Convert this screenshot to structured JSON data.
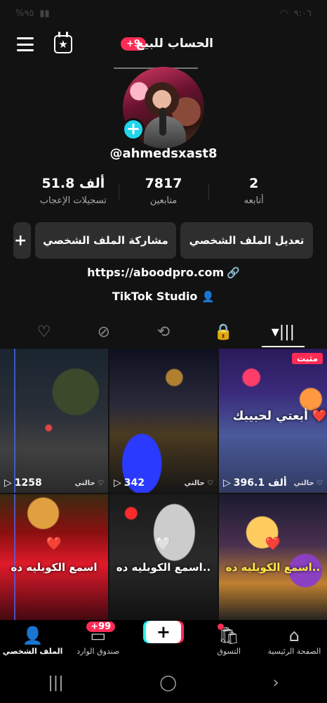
{
  "status_bar": {
    "battery": "%٩٥",
    "time": "٩:٠٦"
  },
  "header": {
    "title": "الحساب للبيع",
    "badge": "+9"
  },
  "profile": {
    "username": "@ahmedsxast8"
  },
  "stats": [
    {
      "value": "51.8 ألف",
      "label": "تسجيلات الإعجاب"
    },
    {
      "value": "7817",
      "label": "متابعين"
    },
    {
      "value": "2",
      "label": "أتابعه"
    }
  ],
  "actions": {
    "edit": "تعديل الملف الشخصي",
    "share": "مشاركة الملف الشخصي",
    "add": "+"
  },
  "link": "https://aboodpro.com",
  "studio": "TikTok Studio",
  "tabs": [
    "liked-icon",
    "hidden-icon",
    "repost-icon",
    "lock-icon",
    "videos-icon"
  ],
  "videos": [
    {
      "views": "1258",
      "caption_small": "حالتي ♡",
      "overlay": ""
    },
    {
      "views": "342",
      "caption_small": "حالتي ♡",
      "overlay": ""
    },
    {
      "views": "396.1 ألف",
      "caption_small": "حالتي ♡",
      "overlay": "أبعتي لحبيبك ❤️",
      "pinned": "مثبت"
    },
    {
      "overlay": "اسمع الكوبليه ده"
    },
    {
      "overlay": "اسمع الكوبليه ده.."
    },
    {
      "overlay": "اسمع الكوبليه ده.."
    }
  ],
  "bottom_nav": {
    "profile": "الملف الشخصي",
    "inbox": "صندوق الوارد",
    "inbox_badge": "+99",
    "shop": "التسوق",
    "home": "الصفحة الرئيسية"
  }
}
